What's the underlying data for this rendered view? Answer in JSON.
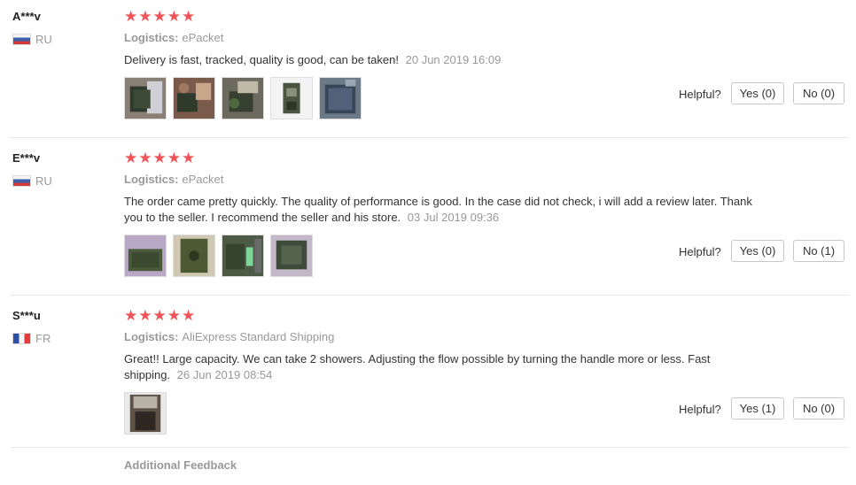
{
  "reviews": [
    {
      "user": "A***v",
      "country": "RU",
      "rating": 5,
      "logistics_label": "Logistics:",
      "logistics_value": "ePacket",
      "text": "Delivery is fast, tracked, quality is good, can be taken!",
      "date": "20 Jun 2019 16:09",
      "photo_count": 5,
      "helpful_label": "Helpful?",
      "yes_label": "Yes (0)",
      "no_label": "No (0)"
    },
    {
      "user": "E***v",
      "country": "RU",
      "rating": 5,
      "logistics_label": "Logistics:",
      "logistics_value": "ePacket",
      "text": "The order came pretty quickly. The quality of performance is good. In the case did not check, i will add a review later. Thank you to the seller. I recommend the seller and his store.",
      "date": "03 Jul 2019 09:36",
      "photo_count": 4,
      "helpful_label": "Helpful?",
      "yes_label": "Yes (0)",
      "no_label": "No (1)"
    },
    {
      "user": "S***u",
      "country": "FR",
      "rating": 5,
      "logistics_label": "Logistics:",
      "logistics_value": "AliExpress Standard Shipping",
      "text": "Great!! Large capacity. We can take 2 showers. Adjusting the flow possible by turning the handle more or less. Fast shipping.",
      "date": "26 Jun 2019 08:54",
      "photo_count": 1,
      "helpful_label": "Helpful?",
      "yes_label": "Yes (1)",
      "no_label": "No (0)"
    }
  ],
  "additional_feedback": "Additional Feedback",
  "colors": {
    "star": "#f05459",
    "muted_text": "#999999",
    "divider": "#e8e8e8"
  }
}
